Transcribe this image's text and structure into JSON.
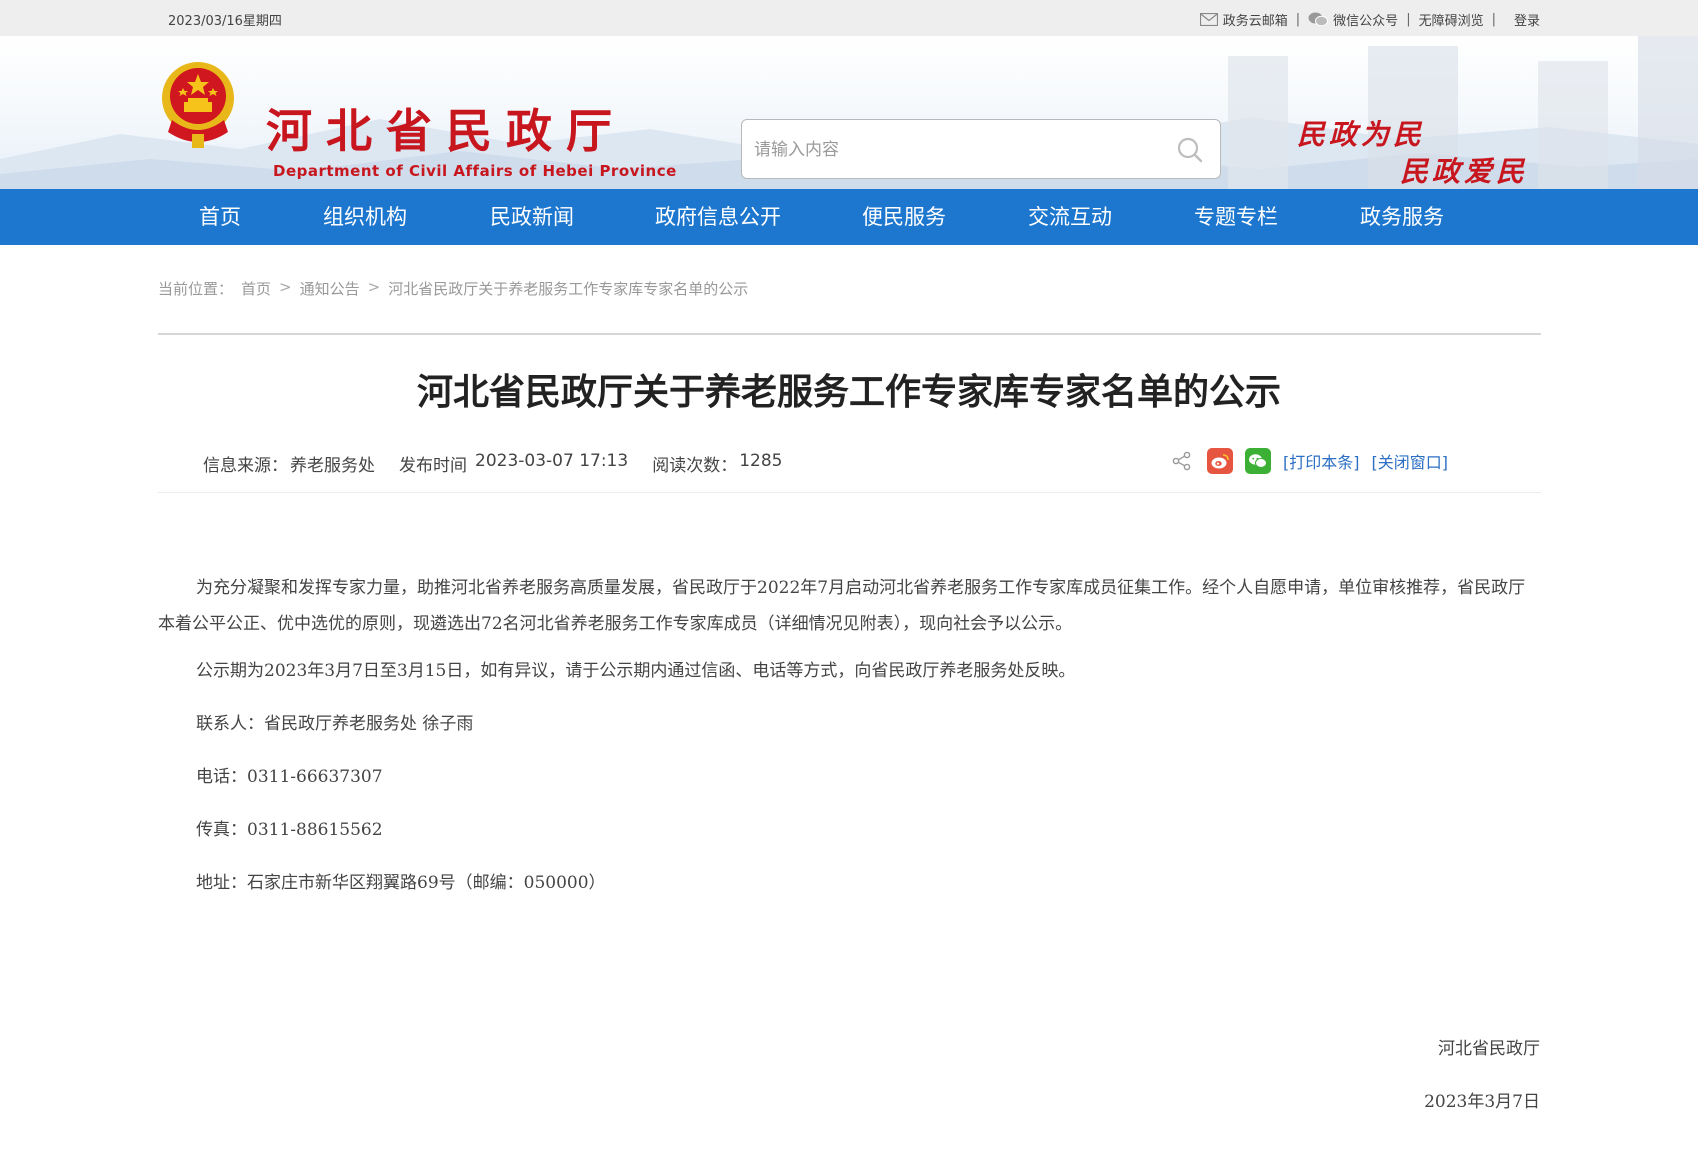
{
  "topbar": {
    "date": "2023/03/16星期四",
    "links": [
      {
        "label": "政务云邮箱",
        "icon": "mail-icon"
      },
      {
        "label": "微信公众号",
        "icon": "wechat-icon"
      },
      {
        "label": "无障碍浏览",
        "icon": ""
      },
      {
        "label": "登录",
        "icon": ""
      }
    ]
  },
  "header": {
    "site_title": "河北省民政厅",
    "site_subtitle": "Department of Civil Affairs of Hebei Province",
    "search_placeholder": "请输入内容",
    "slogan_line1": "民政为民",
    "slogan_line2": "民政爱民",
    "brand_color": "#c8161e"
  },
  "nav": {
    "items": [
      "首页",
      "组织机构",
      "民政新闻",
      "政府信息公开",
      "便民服务",
      "交流互动",
      "专题专栏",
      "政务服务"
    ],
    "bg_color": "#1d77cf"
  },
  "breadcrumb": {
    "prefix": "当前位置：",
    "items": [
      "首页",
      "通知公告",
      "河北省民政厅关于养老服务工作专家库专家名单的公示"
    ],
    "separator": ">"
  },
  "article": {
    "title": "河北省民政厅关于养老服务工作专家库专家名单的公示",
    "source_label": "信息来源：",
    "source_value": "养老服务处",
    "publish_label": "发布时间",
    "publish_value": "2023-03-07 17:13",
    "reads_label": "阅读次数：",
    "reads_value": "1285",
    "print_link": "[打印本条]",
    "close_link": "[关闭窗口]",
    "paragraphs": [
      "为充分凝聚和发挥专家力量，助推河北省养老服务高质量发展，省民政厅于2022年7月启动河北省养老服务工作专家库成员征集工作。经个人自愿申请，单位审核推荐，省民政厅本着公平公正、优中选优的原则，现遴选出72名河北省养老服务工作专家库成员（详细情况见附表），现向社会予以公示。",
      "公示期为2023年3月7日至3月15日，如有异议，请于公示期内通过信函、电话等方式，向省民政厅养老服务处反映。"
    ],
    "contact_lines": [
      "联系人：省民政厅养老服务处 徐子雨",
      "电话：0311-66637307",
      "传真：0311-88615562",
      "地址：石家庄市新华区翔翼路69号（邮编：050000）"
    ],
    "sign_org": "河北省民政厅",
    "sign_date": "2023年3月7日"
  }
}
